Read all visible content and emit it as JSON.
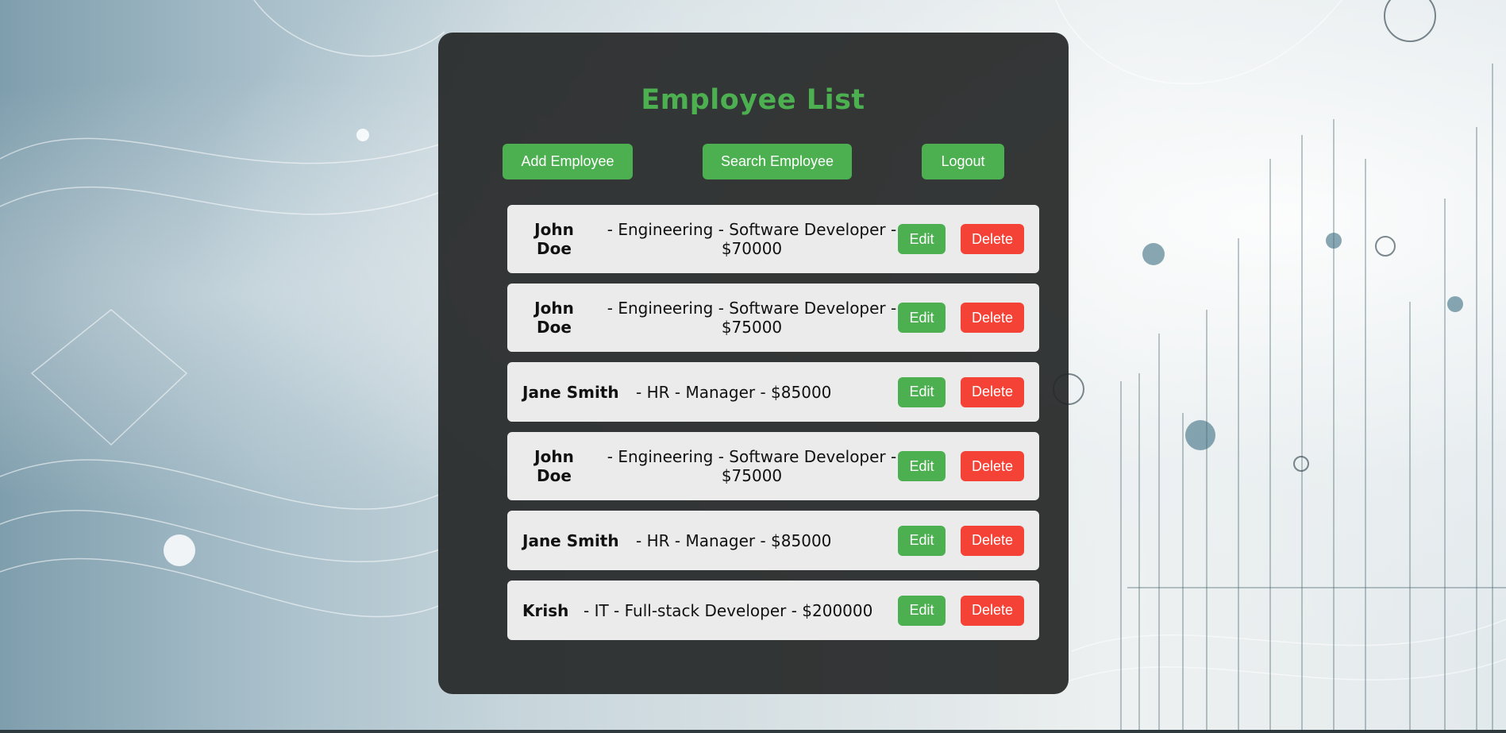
{
  "page": {
    "title": "Employee List"
  },
  "toolbar": {
    "add_label": "Add Employee",
    "search_label": "Search Employee",
    "logout_label": "Logout"
  },
  "employees": [
    {
      "name": "John Doe",
      "detail": "- Engineering - Software Developer - $70000",
      "edit_label": "Edit",
      "delete_label": "Delete"
    },
    {
      "name": "John Doe",
      "detail": "- Engineering - Software Developer - $75000",
      "edit_label": "Edit",
      "delete_label": "Delete"
    },
    {
      "name": "Jane Smith",
      "detail": "- HR - Manager - $85000",
      "edit_label": "Edit",
      "delete_label": "Delete"
    },
    {
      "name": "John Doe",
      "detail": "- Engineering - Software Developer - $75000",
      "edit_label": "Edit",
      "delete_label": "Delete"
    },
    {
      "name": "Jane Smith",
      "detail": "- HR - Manager - $85000",
      "edit_label": "Edit",
      "delete_label": "Delete"
    },
    {
      "name": "Krish",
      "detail": "- IT - Full-stack Developer - $200000",
      "edit_label": "Edit",
      "delete_label": "Delete"
    }
  ],
  "colors": {
    "accent": "#4caf50",
    "danger": "#f44336",
    "panel": "#262828",
    "row": "#ebebeb"
  }
}
